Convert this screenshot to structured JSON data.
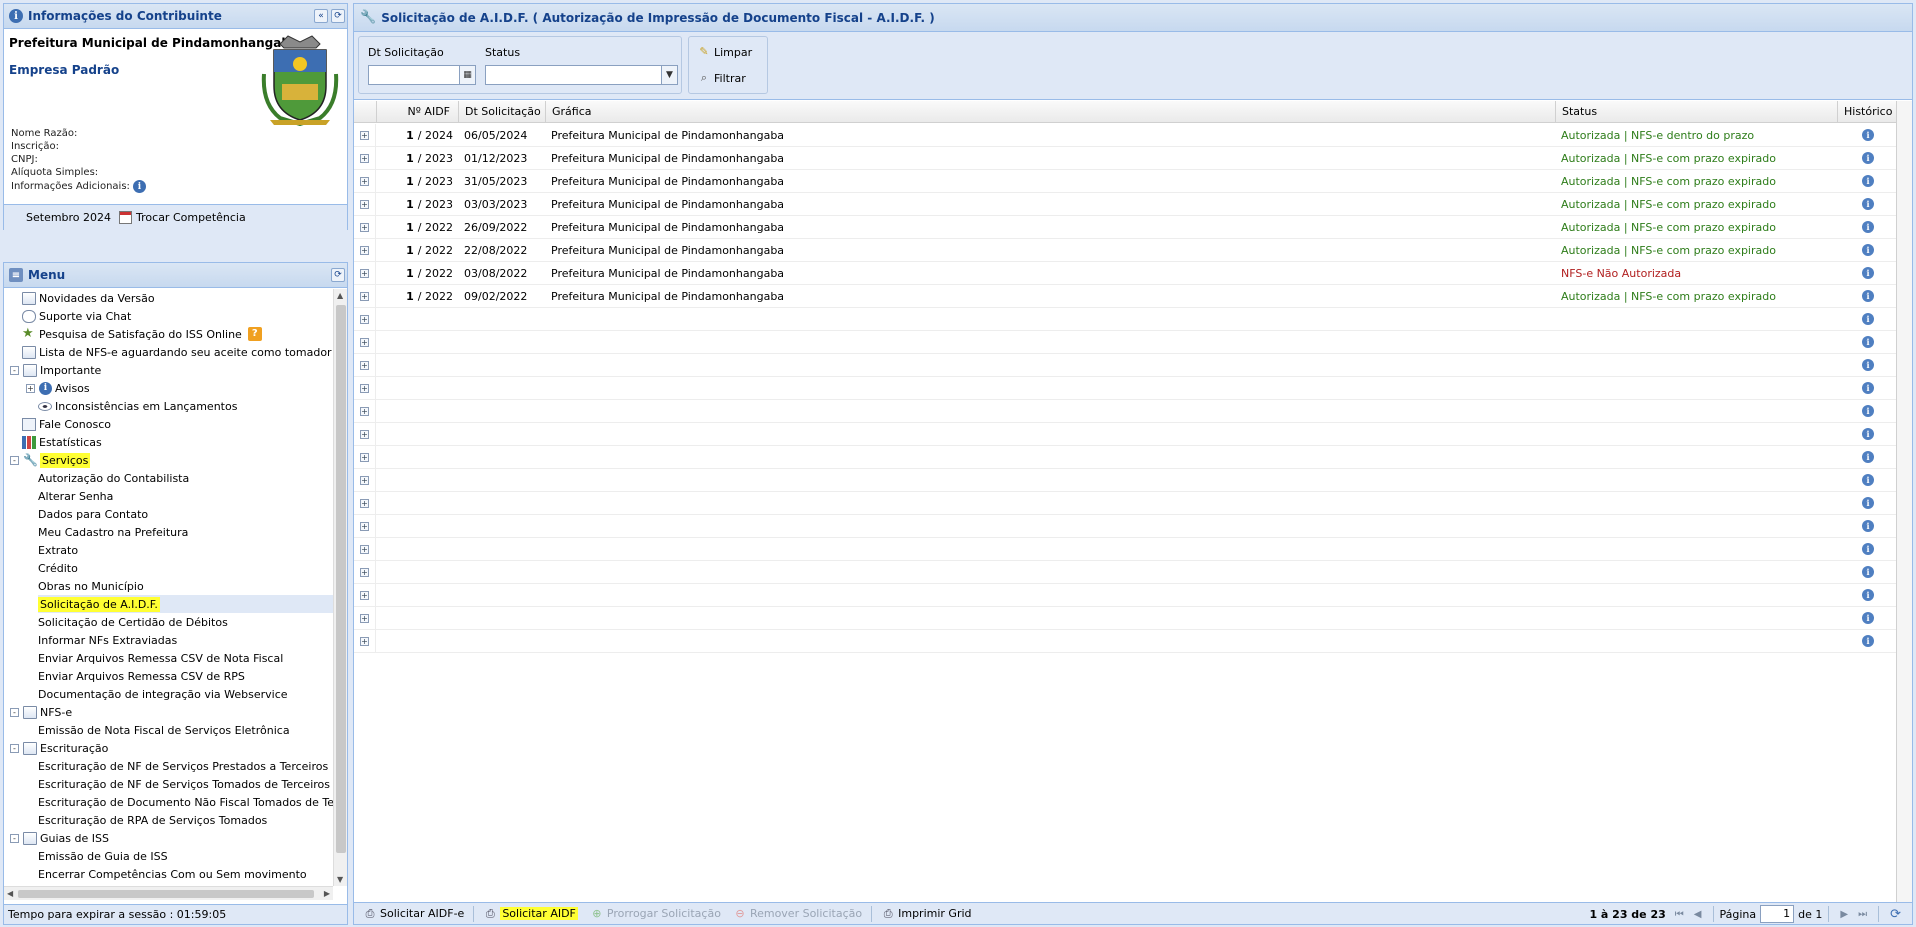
{
  "info_panel": {
    "title": "Informações do Contribuinte",
    "org_name": "Prefeitura Municipal de Pindamonhangaba",
    "company": "Empresa Padrão",
    "labels": [
      "Nome Razão:",
      "Inscrição:",
      "CNPJ:",
      "Alíquota Simples:",
      "Informações Adicionais:"
    ],
    "period": "Setembro 2024",
    "change_period": "Trocar Competência"
  },
  "menu": {
    "title": "Menu",
    "items": [
      {
        "label": "Novidades da Versão",
        "icon": "tag-icon",
        "level": 1
      },
      {
        "label": "Suporte via Chat",
        "icon": "chat-icon",
        "level": 1
      },
      {
        "label": "Pesquisa de Satisfação do ISS Online",
        "icon": "star-icon",
        "level": 1,
        "badge": "?"
      },
      {
        "label": "Lista de NFS-e aguardando seu aceite como tomador",
        "icon": "document-icon",
        "level": 1
      },
      {
        "label": "Importante",
        "icon": "book-icon",
        "level": 0,
        "expander": "-"
      },
      {
        "label": "Avisos",
        "icon": "info-icon",
        "level": 1,
        "expander": "+"
      },
      {
        "label": "Inconsistências em Lançamentos",
        "icon": "eye-icon",
        "level": 2
      },
      {
        "label": "Fale Conosco",
        "icon": "mail-icon",
        "level": 1
      },
      {
        "label": "Estatísticas",
        "icon": "chart-icon",
        "level": 1
      },
      {
        "label": "Serviços",
        "icon": "wrench-icon",
        "level": 0,
        "expander": "-",
        "highlight": true
      },
      {
        "label": "Autorização do Contabilista",
        "level": 1
      },
      {
        "label": "Alterar Senha",
        "level": 1
      },
      {
        "label": "Dados para Contato",
        "level": 1
      },
      {
        "label": "Meu Cadastro na Prefeitura",
        "level": 1
      },
      {
        "label": "Extrato",
        "level": 1
      },
      {
        "label": "Crédito",
        "level": 1
      },
      {
        "label": "Obras no Município",
        "level": 1
      },
      {
        "label": "Solicitação de A.I.D.F.",
        "level": 1,
        "highlight": true,
        "selected": true
      },
      {
        "label": "Solicitação de Certidão de Débitos",
        "level": 1
      },
      {
        "label": "Informar NFs Extraviadas",
        "level": 1
      },
      {
        "label": "Enviar Arquivos Remessa CSV de Nota Fiscal",
        "level": 1
      },
      {
        "label": "Enviar Arquivos Remessa CSV de RPS",
        "level": 1
      },
      {
        "label": "Documentação de integração via Webservice",
        "level": 1
      },
      {
        "label": "NFS-e",
        "icon": "book-icon",
        "level": 0,
        "expander": "-"
      },
      {
        "label": "Emissão de Nota Fiscal de Serviços Eletrônica",
        "level": 1
      },
      {
        "label": "Escrituração",
        "icon": "book-icon",
        "level": 0,
        "expander": "-"
      },
      {
        "label": "Escrituração de NF de Serviços Prestados a Terceiros",
        "level": 1
      },
      {
        "label": "Escrituração de NF de Serviços Tomados de Terceiros",
        "level": 1
      },
      {
        "label": "Escrituração de Documento Não Fiscal Tomados de Terceiros",
        "level": 1
      },
      {
        "label": "Escrituração de RPA de Serviços Tomados",
        "level": 1
      },
      {
        "label": "Guias de ISS",
        "icon": "book-icon",
        "level": 0,
        "expander": "-"
      },
      {
        "label": "Emissão de Guia de ISS",
        "level": 1
      },
      {
        "label": "Encerrar Competências Com ou Sem movimento",
        "level": 1
      }
    ]
  },
  "session": "Tempo para expirar a sessão : 01:59:05",
  "main": {
    "title": "Solicitação de A.I.D.F. ( Autorização de Impressão de Documento Fiscal - A.I.D.F. )",
    "filters": {
      "date_label": "Dt Solicitação",
      "status_label": "Status",
      "clear": "Limpar",
      "filter": "Filtrar"
    },
    "columns": [
      "Nº AIDF",
      "Dt Solicitação",
      "Gráfica",
      "Status",
      "Histórico"
    ],
    "rows": [
      {
        "num": "1",
        "year": "/ 2024",
        "date": "06/05/2024",
        "grafica": "Prefeitura Municipal de Pindamonhangaba",
        "status": "Autorizada | NFS-e dentro do prazo",
        "ok": true
      },
      {
        "num": "1",
        "year": "/ 2023",
        "date": "01/12/2023",
        "grafica": "Prefeitura Municipal de Pindamonhangaba",
        "status": "Autorizada | NFS-e com prazo expirado",
        "ok": true
      },
      {
        "num": "1",
        "year": "/ 2023",
        "date": "31/05/2023",
        "grafica": "Prefeitura Municipal de Pindamonhangaba",
        "status": "Autorizada | NFS-e com prazo expirado",
        "ok": true
      },
      {
        "num": "1",
        "year": "/ 2023",
        "date": "03/03/2023",
        "grafica": "Prefeitura Municipal de Pindamonhangaba",
        "status": "Autorizada | NFS-e com prazo expirado",
        "ok": true
      },
      {
        "num": "1",
        "year": "/ 2022",
        "date": "26/09/2022",
        "grafica": "Prefeitura Municipal de Pindamonhangaba",
        "status": "Autorizada | NFS-e com prazo expirado",
        "ok": true
      },
      {
        "num": "1",
        "year": "/ 2022",
        "date": "22/08/2022",
        "grafica": "Prefeitura Municipal de Pindamonhangaba",
        "status": "Autorizada | NFS-e com prazo expirado",
        "ok": true
      },
      {
        "num": "1",
        "year": "/ 2022",
        "date": "03/08/2022",
        "grafica": "Prefeitura Municipal de Pindamonhangaba",
        "status": "NFS-e Não Autorizada",
        "ok": false
      },
      {
        "num": "1",
        "year": "/ 2022",
        "date": "09/02/2022",
        "grafica": "Prefeitura Municipal de Pindamonhangaba",
        "status": "Autorizada | NFS-e com prazo expirado",
        "ok": true
      }
    ],
    "empty_rows": 15,
    "toolbar": {
      "request_aidfe": "Solicitar AIDF-e",
      "request_aidf": "Solicitar AIDF",
      "extend": "Prorrogar Solicitação",
      "remove": "Remover Solicitação",
      "print": "Imprimir Grid"
    },
    "paging": {
      "summary": "1 à 23 de 23",
      "page_label": "Página",
      "page": "1",
      "of": "de 1"
    }
  },
  "colors": {
    "ok": "#2e7d1a",
    "bad": "#b11f1f",
    "header": "#15428b",
    "highlight": "#ffff33"
  }
}
